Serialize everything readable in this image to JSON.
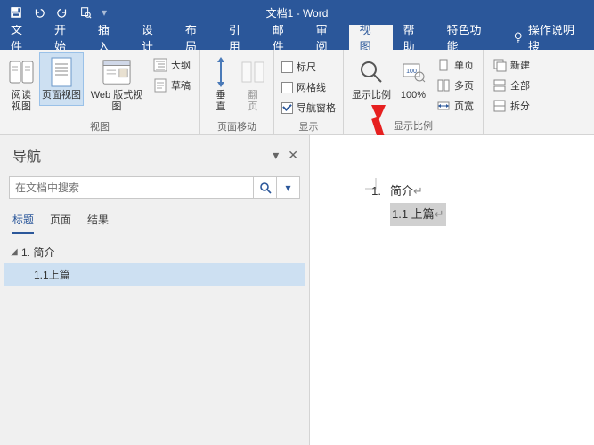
{
  "title": "文档1 - Word",
  "qat": {
    "save": "save",
    "undo": "undo",
    "redo": "redo",
    "preview": "preview"
  },
  "tabs": {
    "items": [
      "文件",
      "开始",
      "插入",
      "设计",
      "布局",
      "引用",
      "邮件",
      "审阅",
      "视图",
      "帮助",
      "特色功能"
    ],
    "active": "视图",
    "tellme": "操作说明搜"
  },
  "ribbon": {
    "views": {
      "label": "视图",
      "read": "阅读\n视图",
      "pageLayout": "页面视图",
      "webLayout": "Web 版式视图",
      "outline": "大纲",
      "draft": "草稿"
    },
    "pageMove": {
      "label": "页面移动",
      "vertical": "垂\n直",
      "flip": "翻\n页"
    },
    "show": {
      "label": "显示",
      "ruler": "标尺",
      "gridlines": "网格线",
      "navPane": "导航窗格",
      "rulerChecked": false,
      "gridChecked": false,
      "navChecked": true
    },
    "zoom": {
      "label": "显示比例",
      "zoom": "显示比例",
      "hundred": "100%",
      "onePage": "单页",
      "multiPage": "多页",
      "pageWidth": "页宽"
    },
    "window": {
      "newWin": "新建",
      "arrange": "全部",
      "split": "拆分"
    }
  },
  "nav": {
    "title": "导航",
    "searchPlaceholder": "在文档中搜索",
    "tabs": {
      "headings": "标题",
      "pages": "页面",
      "results": "结果"
    },
    "activeTab": "标题",
    "items": [
      {
        "level": 1,
        "text": "1. 简介",
        "expanded": true
      },
      {
        "level": 2,
        "text": "1.1上篇",
        "selected": true
      }
    ]
  },
  "document": {
    "listNum": "1.",
    "heading1": "简介",
    "heading2": "1.1 上篇"
  }
}
